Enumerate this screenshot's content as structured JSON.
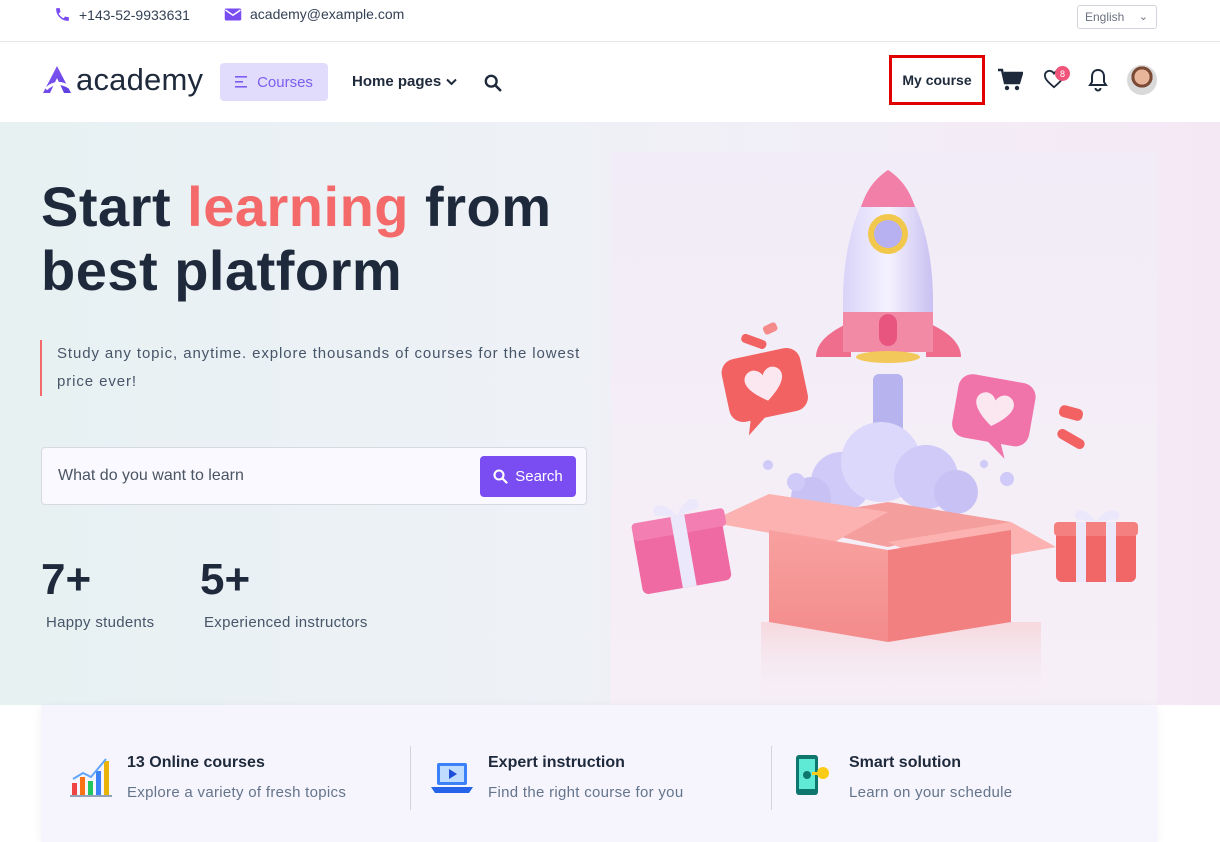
{
  "topbar": {
    "phone": "+143-52-9933631",
    "email": "academy@example.com",
    "language": "English"
  },
  "nav": {
    "logo_text": "academy",
    "courses_label": "Courses",
    "home_pages_label": "Home pages",
    "my_course_label": "My course",
    "wishlist_count": "8"
  },
  "hero": {
    "title_part1": "Start ",
    "title_highlight": "learning",
    "title_part2": " from",
    "title_line2": "best platform",
    "subtitle": "Study any topic, anytime. explore thousands of courses for the lowest price ever!",
    "search_placeholder": "What do you want to learn",
    "search_button": "Search",
    "stats": [
      {
        "value": "7+",
        "label": "Happy students"
      },
      {
        "value": "5+",
        "label": "Experienced instructors"
      }
    ]
  },
  "features": [
    {
      "title": "13 Online courses",
      "desc": "Explore a variety of fresh topics"
    },
    {
      "title": "Expert instruction",
      "desc": "Find the right course for you"
    },
    {
      "title": "Smart solution",
      "desc": "Learn on your schedule"
    }
  ],
  "colors": {
    "accent": "#7a4df3",
    "highlight": "#f46a6a",
    "badge": "#f0547a"
  }
}
